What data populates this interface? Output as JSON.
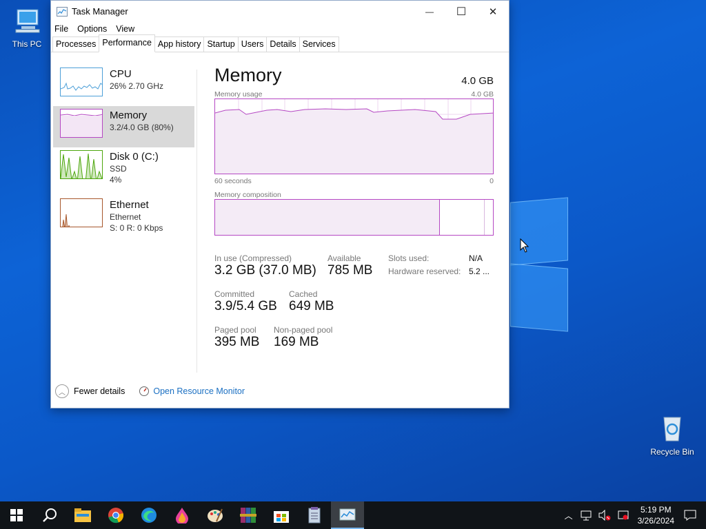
{
  "desktop": {
    "icons": [
      {
        "label": "This PC"
      },
      {
        "label": "Recycle Bin"
      }
    ]
  },
  "window": {
    "title": "Task Manager",
    "controls": {
      "minimize": "—",
      "maximize": "☐",
      "close": "✕"
    },
    "menu": [
      "File",
      "Options",
      "View"
    ],
    "tabs": [
      "Processes",
      "Performance",
      "App history",
      "Startup",
      "Users",
      "Details",
      "Services"
    ],
    "active_tab": "Performance"
  },
  "resources": [
    {
      "name": "CPU",
      "sub1": "26%  2.70 GHz",
      "sub2": "",
      "sub3": "",
      "color": "#4c9fd8"
    },
    {
      "name": "Memory",
      "sub1": "3.2/4.0 GB (80%)",
      "sub2": "",
      "sub3": "",
      "color": "#b547c3"
    },
    {
      "name": "Disk 0 (C:)",
      "sub1": "SSD",
      "sub2": "4%",
      "sub3": "",
      "color": "#4da60c"
    },
    {
      "name": "Ethernet",
      "sub1": "Ethernet",
      "sub2": "S: 0  R: 0 Kbps",
      "sub3": "",
      "color": "#a7572b"
    }
  ],
  "detail": {
    "title": "Memory",
    "total": "4.0 GB",
    "usage_label": "Memory usage",
    "usage_max": "4.0 GB",
    "time_left": "60 seconds",
    "time_right": "0",
    "composition_label": "Memory composition",
    "stats": {
      "in_use_label": "In use (Compressed)",
      "in_use_value": "3.2 GB (37.0 MB)",
      "available_label": "Available",
      "available_value": "785 MB",
      "committed_label": "Committed",
      "committed_value": "3.9/5.4 GB",
      "cached_label": "Cached",
      "cached_value": "649 MB",
      "paged_label": "Paged pool",
      "paged_value": "395 MB",
      "nonpaged_label": "Non-paged pool",
      "nonpaged_value": "169 MB",
      "slots_label": "Slots used:",
      "slots_value": "N/A",
      "hw_label": "Hardware reserved:",
      "hw_value": "5.2 ..."
    }
  },
  "footer": {
    "fewer": "Fewer details",
    "monitor": "Open Resource Monitor"
  },
  "taskbar": {
    "apps": [
      "start-icon",
      "search-icon",
      "file-explorer-icon",
      "chrome-icon",
      "edge-icon",
      "paint-drop-icon",
      "palette-icon",
      "winrar-icon",
      "store-icon",
      "notepad-icon",
      "task-manager-icon"
    ],
    "time": "5:19 PM",
    "date": "3/26/2024"
  }
}
